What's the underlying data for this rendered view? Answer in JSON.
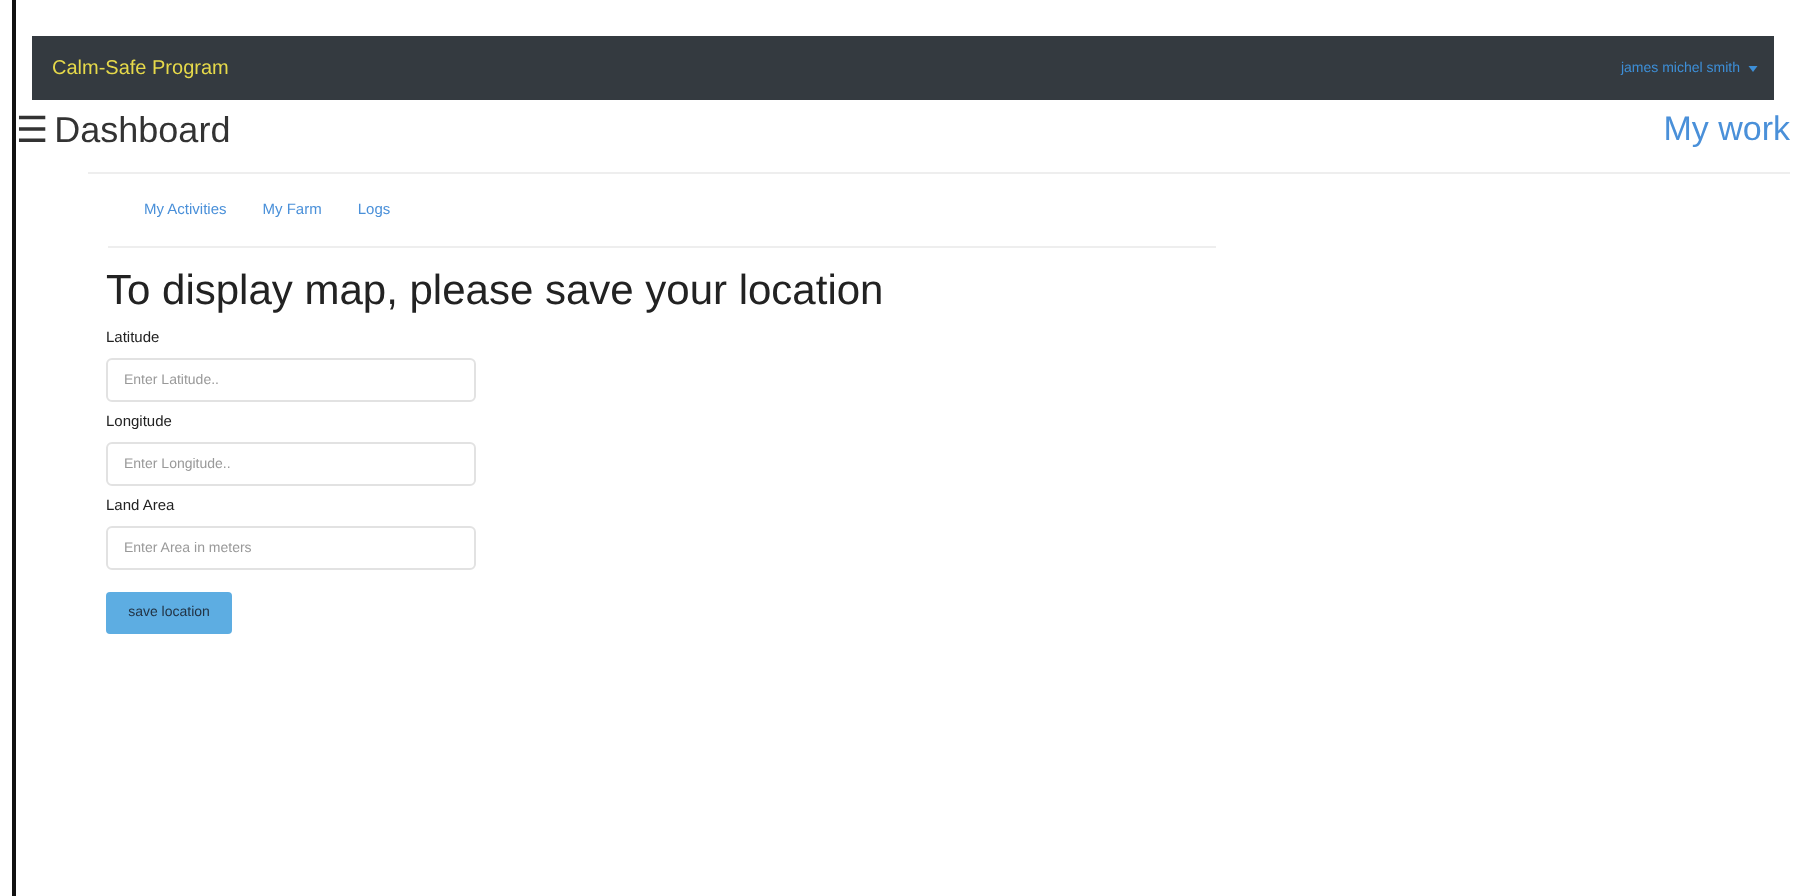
{
  "navbar": {
    "brand": "Calm-Safe Program",
    "user_menu": "james michel smith"
  },
  "header": {
    "menu_glyph": "☰",
    "title": "Dashboard",
    "link": "My work"
  },
  "tabs": [
    {
      "label": "My Activities"
    },
    {
      "label": "My Farm"
    },
    {
      "label": "Logs"
    }
  ],
  "heading": "To display map, please save your location",
  "fields": [
    {
      "label": "Latitude",
      "placeholder": "Enter Latitude.."
    },
    {
      "label": "Longitude",
      "placeholder": "Enter Longitude.."
    },
    {
      "label": "Land Area",
      "placeholder": "Enter Area in meters"
    }
  ],
  "button": "save location"
}
